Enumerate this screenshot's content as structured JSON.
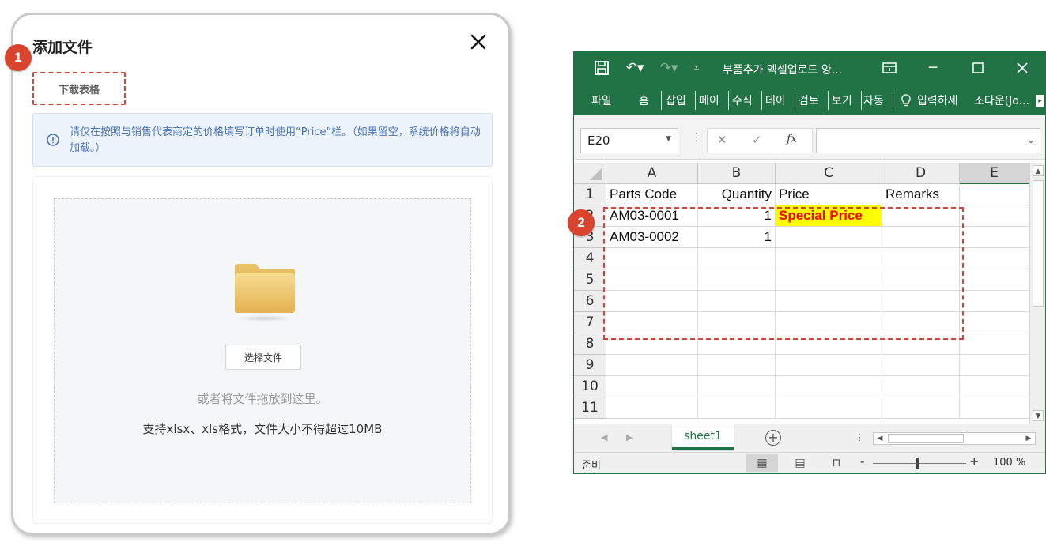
{
  "dialog": {
    "title": "添加文件",
    "download_link": "下载表格",
    "notice": "请仅在按照与销售代表商定的价格填写订单时使用“Price”栏。（如果留空，系统价格将自动加载。）",
    "choose_button": "选择文件",
    "drag_hint": "或者将文件拖放到这里。",
    "format_hint": "支持xlsx、xls格式，文件大小不得超过10MB"
  },
  "badges": {
    "first": "1",
    "second": "2"
  },
  "excel": {
    "doc_title": "부품추가 엑셀업로드 양...",
    "menu": [
      "파일",
      "홈",
      "삽입",
      "페이",
      "수식",
      "데이",
      "검토",
      "보기",
      "자동"
    ],
    "tell_me": "입력하세",
    "user": "조다운(Jo...",
    "name_box": "E20",
    "columns": [
      "A",
      "B",
      "C",
      "D",
      "E"
    ],
    "rows": [
      {
        "num": "1",
        "a": "Parts Code",
        "b": "Quantity",
        "c": "Price",
        "d": "Remarks"
      },
      {
        "num": "2",
        "a": "AM03-0001",
        "b": "1",
        "c": "Special Price",
        "d": ""
      },
      {
        "num": "3",
        "a": "AM03-0002",
        "b": "1",
        "c": "",
        "d": ""
      },
      {
        "num": "4",
        "a": "",
        "b": "",
        "c": "",
        "d": ""
      },
      {
        "num": "5",
        "a": "",
        "b": "",
        "c": "",
        "d": ""
      },
      {
        "num": "6",
        "a": "",
        "b": "",
        "c": "",
        "d": ""
      },
      {
        "num": "7",
        "a": "",
        "b": "",
        "c": "",
        "d": ""
      },
      {
        "num": "8",
        "a": "",
        "b": "",
        "c": "",
        "d": ""
      },
      {
        "num": "9",
        "a": "",
        "b": "",
        "c": "",
        "d": ""
      },
      {
        "num": "10",
        "a": "",
        "b": "",
        "c": "",
        "d": ""
      },
      {
        "num": "11",
        "a": "",
        "b": "",
        "c": "",
        "d": ""
      }
    ],
    "sheet_tab": "sheet1",
    "status": "준비",
    "zoom": "100 %",
    "zoom_minus": "-",
    "zoom_plus": "+",
    "accent": "#217346",
    "highlight_fill": "#ffff00",
    "highlight_text": "#ff0000"
  }
}
